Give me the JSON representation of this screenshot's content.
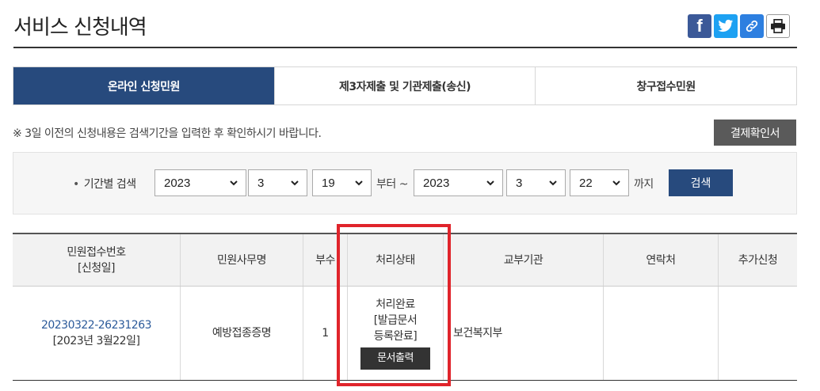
{
  "header": {
    "title": "서비스 신청내역"
  },
  "share": {
    "facebook_glyph": "f",
    "icons": [
      "facebook-icon",
      "twitter-icon",
      "link-icon",
      "print-icon"
    ]
  },
  "tabs": [
    {
      "label": "온라인 신청민원",
      "active": true
    },
    {
      "label": "제3자제출 및 기관제출(송신)",
      "active": false
    },
    {
      "label": "창구접수민원",
      "active": false
    }
  ],
  "notice": "※ 3일 이전의 신청내용은 검색기간을 입력한 후 확인하시기 바랍니다.",
  "confirm_button": "결제확인서",
  "search": {
    "label": "기간별 검색",
    "from": {
      "year": "2023",
      "month": "3",
      "day": "19"
    },
    "from_suffix": "부터 ~",
    "to": {
      "year": "2023",
      "month": "3",
      "day": "22"
    },
    "to_suffix": "까지",
    "button": "검색"
  },
  "table": {
    "headers": {
      "receipt_no": "민원접수번호",
      "receipt_date": "[신청일]",
      "office_name": "민원사무명",
      "copies": "부수",
      "status": "처리상태",
      "agency": "교부기관",
      "contact": "연락처",
      "extra": "추가신청"
    },
    "row": {
      "receipt_no": "20230322-26231263",
      "receipt_date": "[2023년 3월22일]",
      "office_name": "예방접종증명",
      "copies": "1",
      "status_line1": "처리완료",
      "status_line2": "[발급문서",
      "status_line3": "등록완료]",
      "print_button": "문서출력",
      "agency": "보건복지부",
      "contact": "",
      "extra": ""
    }
  },
  "colors": {
    "accent": "#274a7d",
    "highlight": "#e0242b",
    "facebook": "#3b5998",
    "twitter": "#1da1f2"
  }
}
